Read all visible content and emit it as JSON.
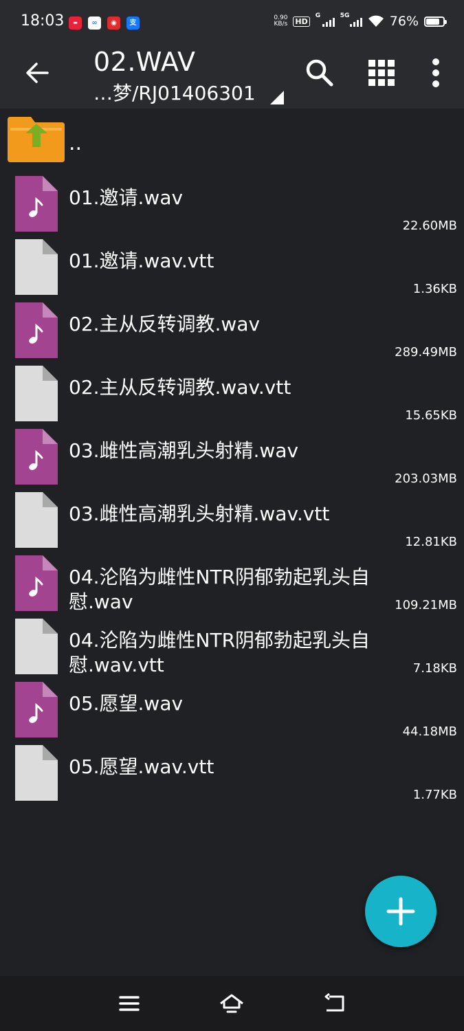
{
  "status_bar": {
    "time": "18:03",
    "net_speed_value": "0.90",
    "net_speed_unit": "KB/s",
    "hd_badge": "HD",
    "signal1_label": "G",
    "signal2_label": "5G",
    "battery": "76%"
  },
  "app_bar": {
    "title": "02.WAV",
    "path": "…梦/RJ01406301"
  },
  "parent_folder": {
    "label": ".."
  },
  "files": [
    {
      "name": "01.邀请.wav",
      "size": "22.60MB",
      "type": "audio"
    },
    {
      "name": "01.邀请.wav.vtt",
      "size": "1.36KB",
      "type": "doc"
    },
    {
      "name": "02.主从反转调教.wav",
      "size": "289.49MB",
      "type": "audio"
    },
    {
      "name": "02.主从反转调教.wav.vtt",
      "size": "15.65KB",
      "type": "doc"
    },
    {
      "name": "03.雌性高潮乳头射精.wav",
      "size": "203.03MB",
      "type": "audio"
    },
    {
      "name": "03.雌性高潮乳头射精.wav.vtt",
      "size": "12.81KB",
      "type": "doc"
    },
    {
      "name": "04.沦陷为雌性NTR阴郁勃起乳头自慰.wav",
      "size": "109.21MB",
      "type": "audio"
    },
    {
      "name": "04.沦陷为雌性NTR阴郁勃起乳头自慰.wav.vtt",
      "size": "7.18KB",
      "type": "doc"
    },
    {
      "name": "05.愿望.wav",
      "size": "44.18MB",
      "type": "audio"
    },
    {
      "name": "05.愿望.wav.vtt",
      "size": "1.77KB",
      "type": "doc"
    }
  ],
  "colors": {
    "background": "#202124",
    "appbar": "#2a2b2e",
    "audio_icon": "#a2448f",
    "doc_icon": "#dcdcdc",
    "fab": "#17b3c8",
    "folder": "#f29a1c",
    "folder_arrow": "#7cae24"
  }
}
